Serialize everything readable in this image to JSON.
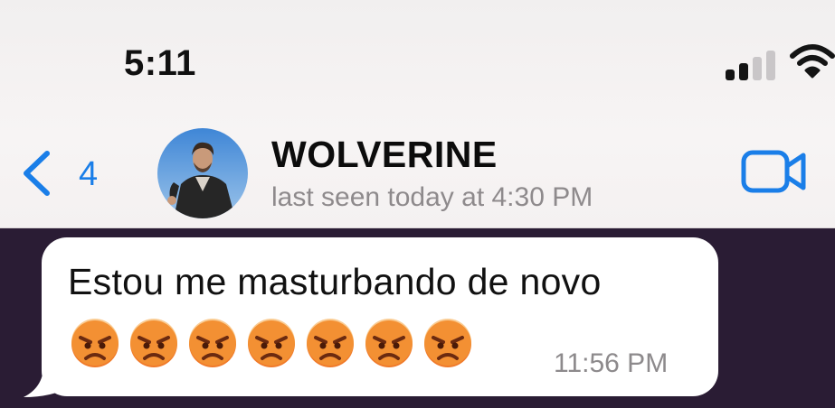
{
  "status_bar": {
    "time": "5:11",
    "signal_icon": "cellular-signal-icon",
    "wifi_icon": "wifi-icon"
  },
  "chat_header": {
    "back_icon": "chevron-left-icon",
    "back_count": "4",
    "contact_name": "WOLVERINE",
    "last_seen": "last seen today at 4:30 PM",
    "video_icon": "video-camera-icon",
    "accent_color": "#1a7ee8"
  },
  "messages": [
    {
      "text": "Estou me masturbando de novo",
      "emojis": "😡😡😡😡😡😡😡",
      "emoji_icon": "angry-face-icon",
      "time": "11:56 PM"
    }
  ],
  "colors": {
    "chat_background": "#2a1c34",
    "bubble": "#ffffff"
  }
}
